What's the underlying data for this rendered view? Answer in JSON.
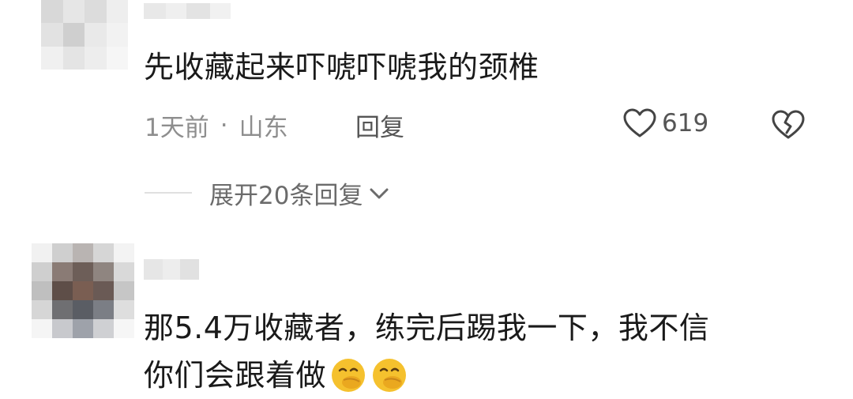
{
  "comments": [
    {
      "text": "先收藏起来吓唬吓唬我的颈椎",
      "time": "1天前",
      "separator": "·",
      "location": "山东",
      "reply_label": "回复",
      "like_count": "619",
      "like_icon": "heart-outline-icon",
      "dislike_icon": "broken-heart-icon",
      "expand_label": "展开20条回复"
    },
    {
      "text_line1": "那5.4万收藏者，练完后踢我一下，我不信",
      "text_line2": "你们会跟着做",
      "emoji": [
        "face-with-hand-over-mouth-emoji",
        "face-with-hand-over-mouth-emoji"
      ]
    }
  ],
  "colors": {
    "text": "#1a1a1a",
    "meta": "#8e8e8e",
    "divider": "#e0e0e0",
    "emoji": "#f5c12e"
  }
}
